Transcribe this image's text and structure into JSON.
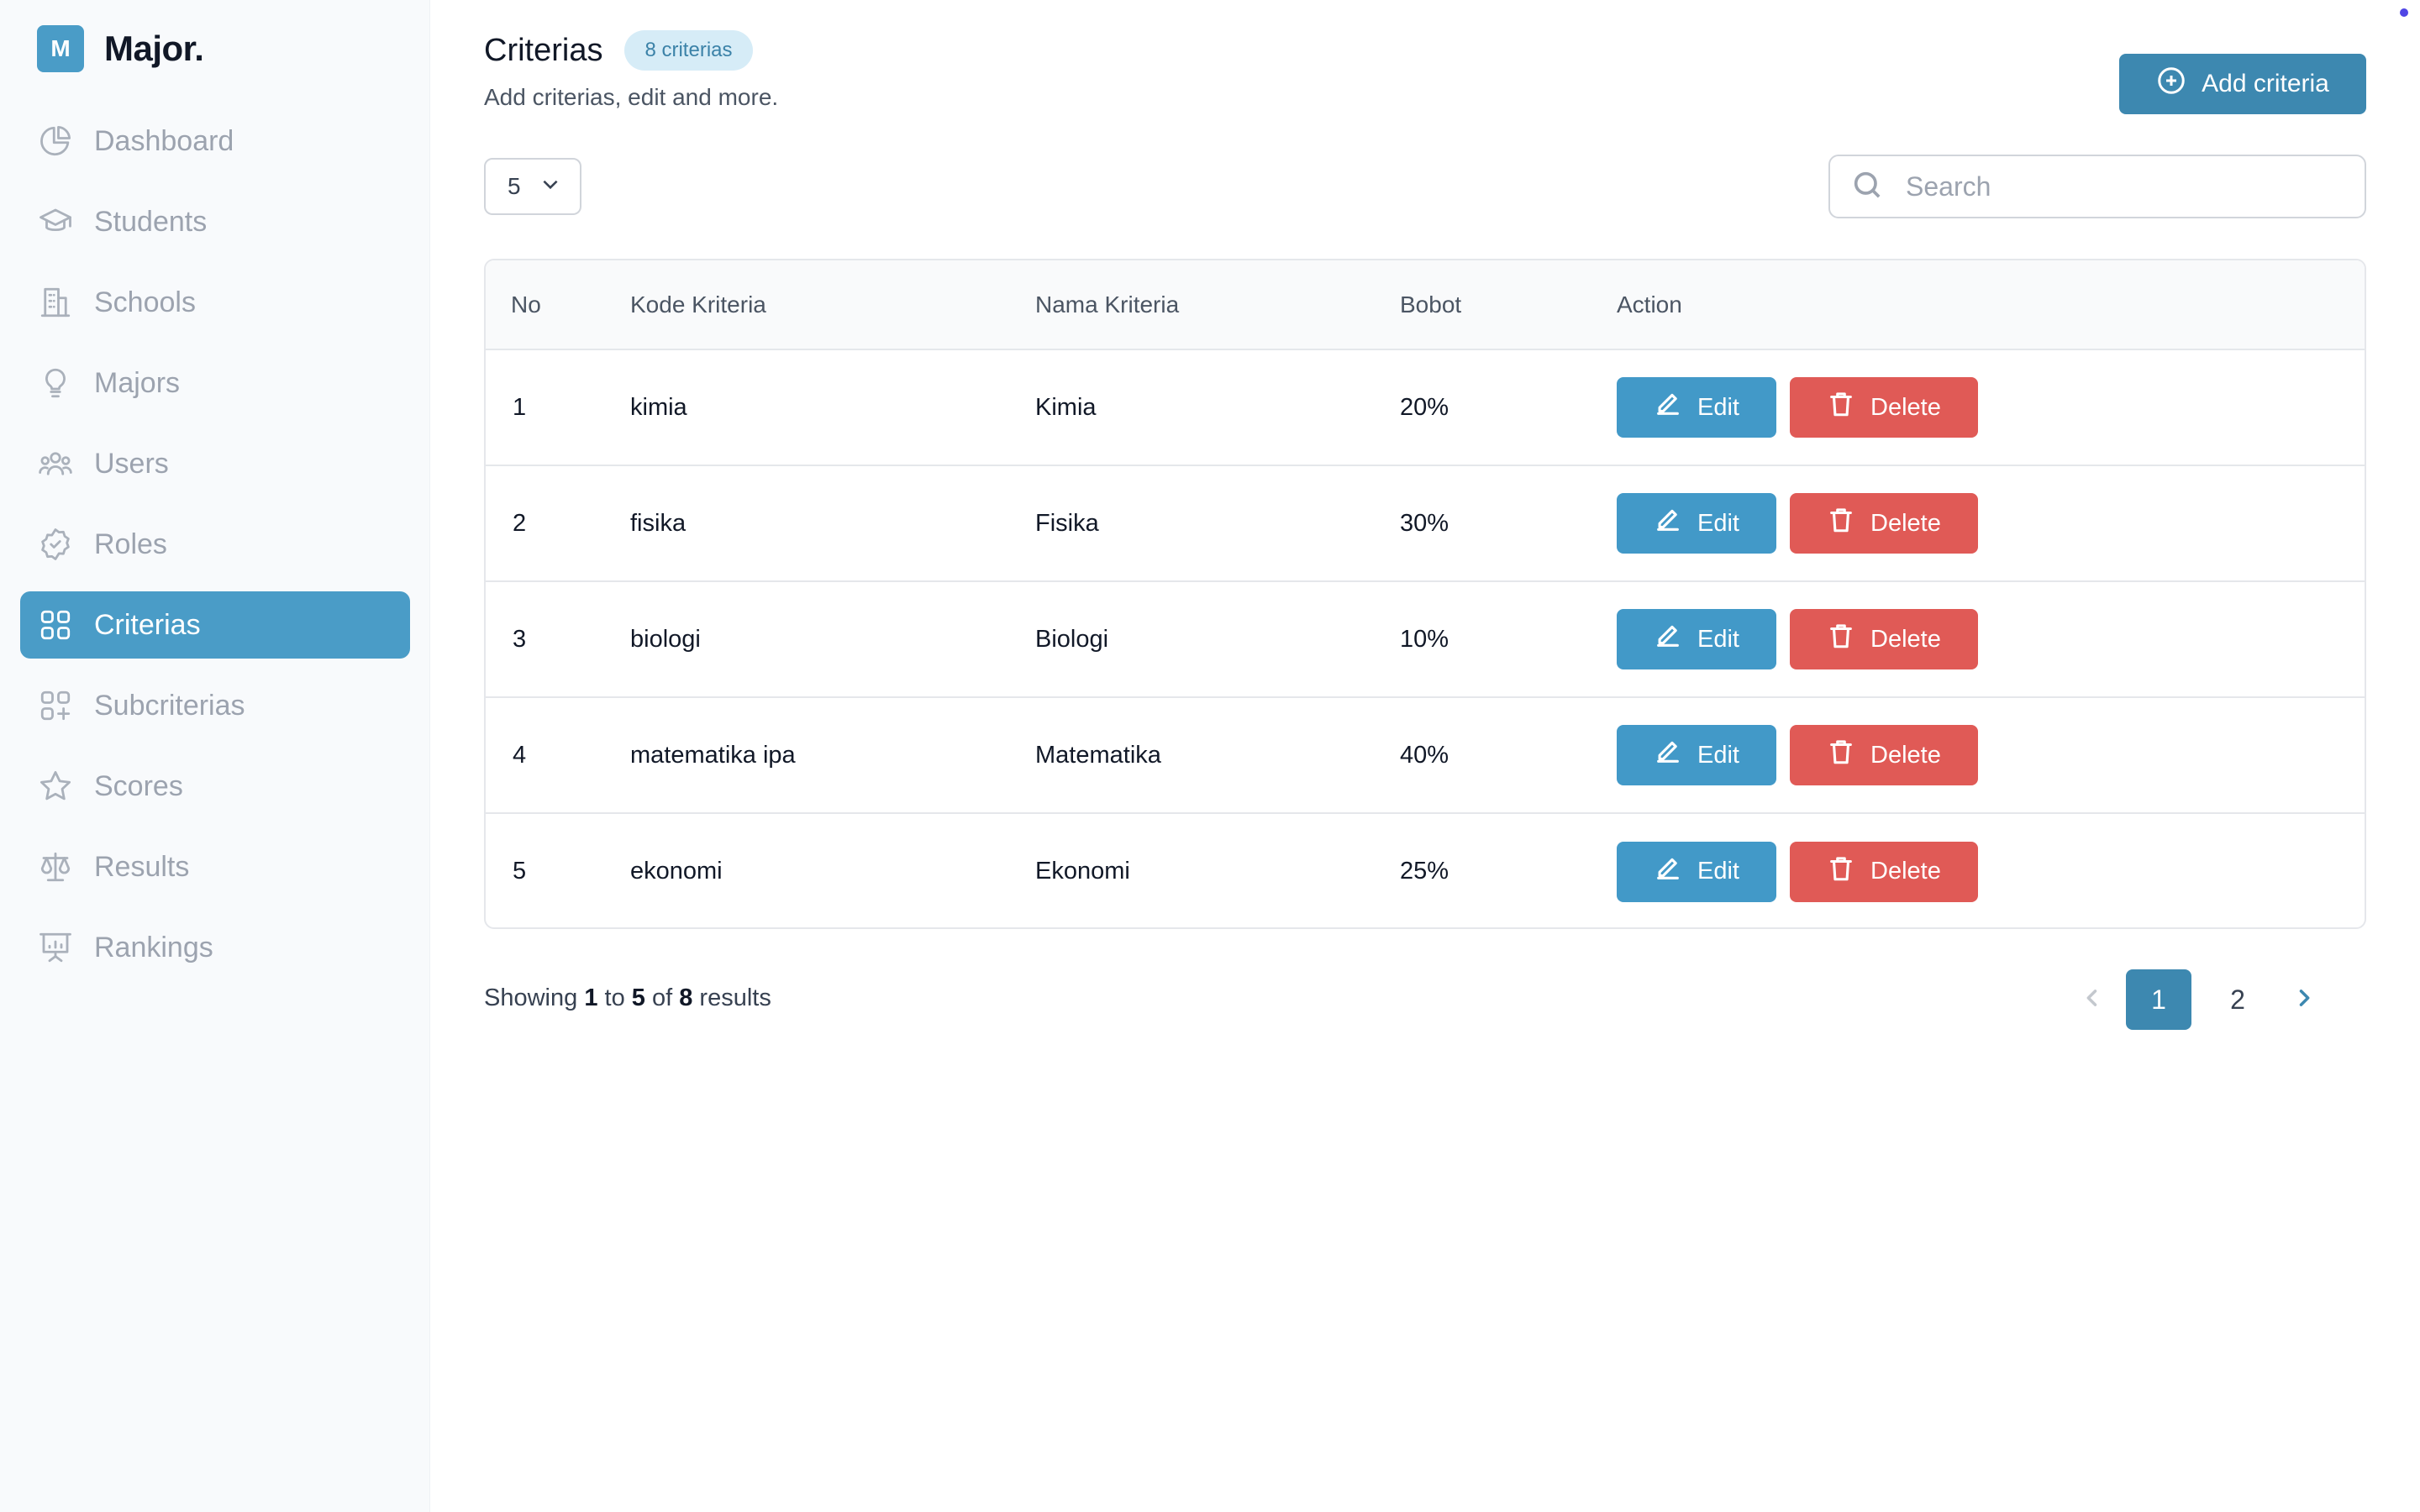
{
  "brand": {
    "logo_letter": "M",
    "name": "Major."
  },
  "sidebar": {
    "items": [
      {
        "label": "Dashboard",
        "icon": "pie-chart-icon"
      },
      {
        "label": "Students",
        "icon": "graduation-cap-icon"
      },
      {
        "label": "Schools",
        "icon": "building-icon"
      },
      {
        "label": "Majors",
        "icon": "lightbulb-icon"
      },
      {
        "label": "Users",
        "icon": "users-icon"
      },
      {
        "label": "Roles",
        "icon": "badge-icon"
      },
      {
        "label": "Criterias",
        "icon": "grid-icon",
        "active": true
      },
      {
        "label": "Subcriterias",
        "icon": "grid-plus-icon"
      },
      {
        "label": "Scores",
        "icon": "star-icon"
      },
      {
        "label": "Results",
        "icon": "scale-icon"
      },
      {
        "label": "Rankings",
        "icon": "presentation-icon"
      }
    ]
  },
  "header": {
    "title": "Criterias",
    "badge": "8 criterias",
    "subtitle": "Add criterias, edit and more.",
    "add_button": "Add criteria"
  },
  "controls": {
    "page_size": "5",
    "search_placeholder": "Search"
  },
  "table": {
    "columns": [
      "No",
      "Kode Kriteria",
      "Nama Kriteria",
      "Bobot",
      "Action"
    ],
    "rows": [
      {
        "no": "1",
        "kode": "kimia",
        "nama": "Kimia",
        "bobot": "20%"
      },
      {
        "no": "2",
        "kode": "fisika",
        "nama": "Fisika",
        "bobot": "30%"
      },
      {
        "no": "3",
        "kode": "biologi",
        "nama": "Biologi",
        "bobot": "10%"
      },
      {
        "no": "4",
        "kode": "matematika ipa",
        "nama": "Matematika",
        "bobot": "40%"
      },
      {
        "no": "5",
        "kode": "ekonomi",
        "nama": "Ekonomi",
        "bobot": "25%"
      }
    ],
    "edit_label": "Edit",
    "delete_label": "Delete"
  },
  "footer": {
    "showing_prefix": "Showing",
    "from": "1",
    "to_word": "to",
    "to": "5",
    "of_word": "of",
    "total": "8",
    "results_word": "results"
  },
  "pagination": {
    "pages": [
      "1",
      "2"
    ],
    "current": "1"
  },
  "colors": {
    "accent": "#4a9cc7",
    "primary_button": "#3d88b0",
    "edit_button": "#4299c8",
    "delete_button": "#e05a56"
  }
}
